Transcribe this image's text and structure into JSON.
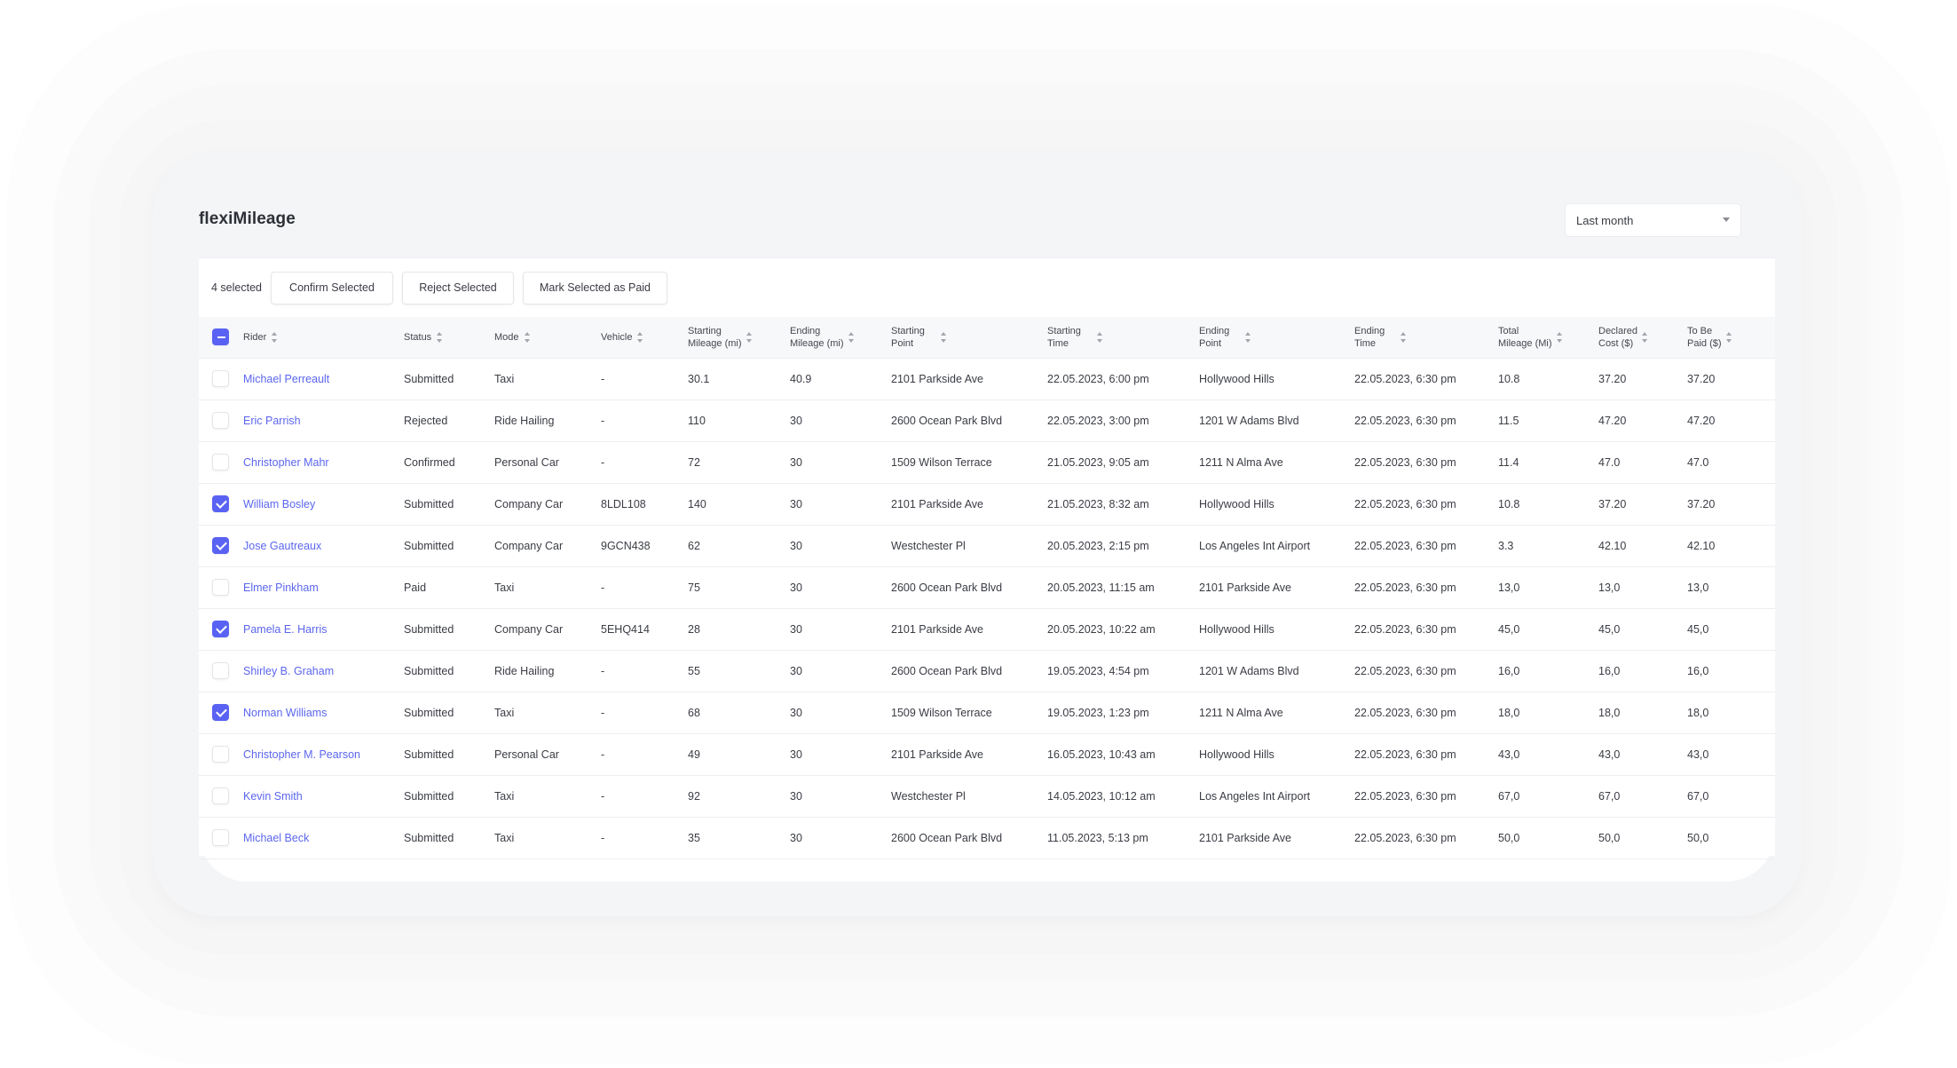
{
  "app": {
    "title": "flexiMileage"
  },
  "filter": {
    "selected": "Last month"
  },
  "actions": {
    "selected_count": "4 selected",
    "confirm_label": "Confirm Selected",
    "reject_label": "Reject Selected",
    "mark_paid_label": "Mark Selected as Paid"
  },
  "colors": {
    "accent": "#5a62f3",
    "link": "#5b66ee"
  },
  "table": {
    "columns": [
      {
        "l1": "Rider",
        "l2": ""
      },
      {
        "l1": "Status",
        "l2": ""
      },
      {
        "l1": "Mode",
        "l2": ""
      },
      {
        "l1": "Vehicle",
        "l2": ""
      },
      {
        "l1": "Starting",
        "l2": "Mileage (mi)"
      },
      {
        "l1": "Ending",
        "l2": "Mileage (mi)"
      },
      {
        "l1": "Starting",
        "l2": "Point"
      },
      {
        "l1": "Starting",
        "l2": "Time"
      },
      {
        "l1": "Ending",
        "l2": "Point"
      },
      {
        "l1": "Ending",
        "l2": "Time"
      },
      {
        "l1": "Total",
        "l2": "Mileage (Mi)"
      },
      {
        "l1": "Declared",
        "l2": "Cost ($)"
      },
      {
        "l1": "To Be",
        "l2": "Paid ($)"
      }
    ],
    "rows": [
      {
        "checked": false,
        "rider": "Michael Perreault",
        "status": "Submitted",
        "mode": "Taxi",
        "vehicle": "-",
        "start_mileage": "30.1",
        "end_mileage": "40.9",
        "start_point": "2101 Parkside Ave",
        "start_time": "22.05.2023, 6:00 pm",
        "end_point": "Hollywood Hills",
        "end_time": "22.05.2023, 6:30 pm",
        "total_mileage": "10.8",
        "declared_cost": "37.20",
        "to_be_paid": "37.20"
      },
      {
        "checked": false,
        "rider": "Eric Parrish",
        "status": "Rejected",
        "mode": "Ride Hailing",
        "vehicle": "-",
        "start_mileage": "110",
        "end_mileage": "30",
        "start_point": "2600 Ocean Park Blvd",
        "start_time": "22.05.2023, 3:00 pm",
        "end_point": "1201 W Adams Blvd",
        "end_time": "22.05.2023, 6:30 pm",
        "total_mileage": "11.5",
        "declared_cost": "47.20",
        "to_be_paid": "47.20"
      },
      {
        "checked": false,
        "rider": "Christopher Mahr",
        "status": "Confirmed",
        "mode": "Personal Car",
        "vehicle": "-",
        "start_mileage": "72",
        "end_mileage": "30",
        "start_point": "1509 Wilson Terrace",
        "start_time": "21.05.2023, 9:05 am",
        "end_point": "1211 N Alma Ave",
        "end_time": "22.05.2023, 6:30 pm",
        "total_mileage": "11.4",
        "declared_cost": "47.0",
        "to_be_paid": "47.0"
      },
      {
        "checked": true,
        "rider": "William Bosley",
        "status": "Submitted",
        "mode": "Company Car",
        "vehicle": "8LDL108",
        "start_mileage": "140",
        "end_mileage": "30",
        "start_point": "2101 Parkside Ave",
        "start_time": "21.05.2023, 8:32 am",
        "end_point": "Hollywood Hills",
        "end_time": "22.05.2023, 6:30 pm",
        "total_mileage": "10.8",
        "declared_cost": "37.20",
        "to_be_paid": "37.20"
      },
      {
        "checked": true,
        "rider": "Jose Gautreaux",
        "status": "Submitted",
        "mode": "Company Car",
        "vehicle": "9GCN438",
        "start_mileage": "62",
        "end_mileage": "30",
        "start_point": "Westchester Pl",
        "start_time": "20.05.2023, 2:15 pm",
        "end_point": "Los Angeles Int Airport",
        "end_time": "22.05.2023, 6:30 pm",
        "total_mileage": "3.3",
        "declared_cost": "42.10",
        "to_be_paid": "42.10"
      },
      {
        "checked": false,
        "rider": "Elmer Pinkham",
        "status": "Paid",
        "mode": "Taxi",
        "vehicle": "-",
        "start_mileage": "75",
        "end_mileage": "30",
        "start_point": "2600 Ocean Park Blvd",
        "start_time": "20.05.2023, 11:15 am",
        "end_point": "2101 Parkside Ave",
        "end_time": "22.05.2023, 6:30 pm",
        "total_mileage": "13,0",
        "declared_cost": "13,0",
        "to_be_paid": "13,0"
      },
      {
        "checked": true,
        "rider": "Pamela E. Harris",
        "status": "Submitted",
        "mode": "Company Car",
        "vehicle": "5EHQ414",
        "start_mileage": "28",
        "end_mileage": "30",
        "start_point": "2101 Parkside Ave",
        "start_time": "20.05.2023, 10:22 am",
        "end_point": "Hollywood Hills",
        "end_time": "22.05.2023, 6:30 pm",
        "total_mileage": "45,0",
        "declared_cost": "45,0",
        "to_be_paid": "45,0"
      },
      {
        "checked": false,
        "rider": "Shirley B. Graham",
        "status": "Submitted",
        "mode": "Ride Hailing",
        "vehicle": "-",
        "start_mileage": "55",
        "end_mileage": "30",
        "start_point": "2600 Ocean Park Blvd",
        "start_time": "19.05.2023, 4:54 pm",
        "end_point": "1201 W Adams Blvd",
        "end_time": "22.05.2023, 6:30 pm",
        "total_mileage": "16,0",
        "declared_cost": "16,0",
        "to_be_paid": "16,0"
      },
      {
        "checked": true,
        "rider": "Norman Williams",
        "status": "Submitted",
        "mode": "Taxi",
        "vehicle": "-",
        "start_mileage": "68",
        "end_mileage": "30",
        "start_point": "1509 Wilson Terrace",
        "start_time": "19.05.2023, 1:23 pm",
        "end_point": "1211 N Alma Ave",
        "end_time": "22.05.2023, 6:30 pm",
        "total_mileage": "18,0",
        "declared_cost": "18,0",
        "to_be_paid": "18,0"
      },
      {
        "checked": false,
        "rider": "Christopher M. Pearson",
        "status": "Submitted",
        "mode": "Personal Car",
        "vehicle": "-",
        "start_mileage": "49",
        "end_mileage": "30",
        "start_point": "2101 Parkside Ave",
        "start_time": "16.05.2023, 10:43 am",
        "end_point": "Hollywood Hills",
        "end_time": "22.05.2023, 6:30 pm",
        "total_mileage": "43,0",
        "declared_cost": "43,0",
        "to_be_paid": "43,0"
      },
      {
        "checked": false,
        "rider": "Kevin Smith",
        "status": "Submitted",
        "mode": "Taxi",
        "vehicle": "-",
        "start_mileage": "92",
        "end_mileage": "30",
        "start_point": "Westchester Pl",
        "start_time": "14.05.2023, 10:12 am",
        "end_point": "Los Angeles Int Airport",
        "end_time": "22.05.2023, 6:30 pm",
        "total_mileage": "67,0",
        "declared_cost": "67,0",
        "to_be_paid": "67,0"
      },
      {
        "checked": false,
        "rider": "Michael Beck",
        "status": "Submitted",
        "mode": "Taxi",
        "vehicle": "-",
        "start_mileage": "35",
        "end_mileage": "30",
        "start_point": "2600 Ocean Park Blvd",
        "start_time": "11.05.2023, 5:13 pm",
        "end_point": "2101 Parkside Ave",
        "end_time": "22.05.2023, 6:30 pm",
        "total_mileage": "50,0",
        "declared_cost": "50,0",
        "to_be_paid": "50,0"
      }
    ]
  }
}
